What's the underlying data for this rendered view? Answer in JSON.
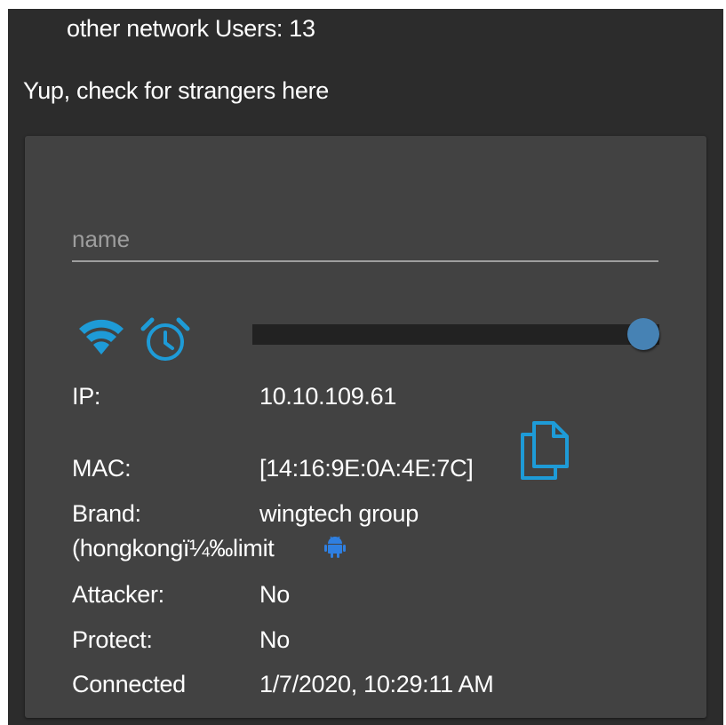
{
  "header": {
    "network_users": "other network Users: 13"
  },
  "section": {
    "title": "Yup, check for strangers here"
  },
  "device": {
    "name_placeholder": "name",
    "slider_level": 1.0,
    "fields": {
      "ip_label": "IP:",
      "ip_value": "10.10.109.61",
      "mac_label": "MAC:",
      "mac_value": "[14:16:9E:0A:4E:7C]",
      "brand_label": "Brand:",
      "brand_value_line1": "wingtech group",
      "brand_value_line2": "(hongkongï¼‰limit",
      "attacker_label": "Attacker:",
      "attacker_value": "No",
      "protect_label": "Protect:",
      "protect_value": "No",
      "connected_label": "Connected",
      "connected_value": "1/7/2020, 10:29:11 AM"
    }
  },
  "icons": {
    "wifi": "wifi-icon",
    "alarm": "alarm-clock-icon",
    "copy": "copy-icon",
    "android": "android-icon"
  },
  "colors": {
    "accent_blue": "#1e9bd7",
    "android_blue": "#2f7fe0",
    "slider_thumb": "#4682b4",
    "card_bg": "#424242",
    "page_bg": "#2c2c2c"
  }
}
